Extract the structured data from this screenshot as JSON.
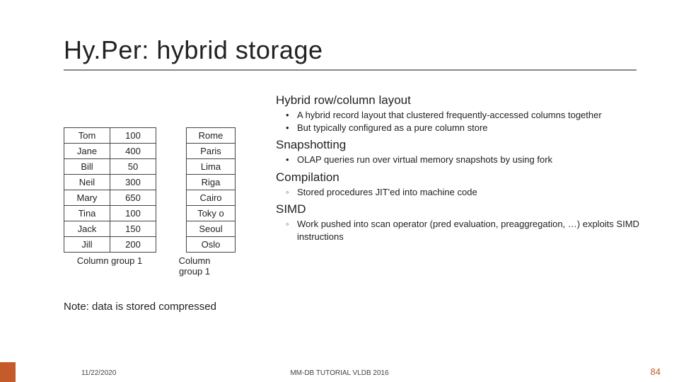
{
  "title": "Hy.Per: hybrid storage",
  "table": {
    "rows": [
      {
        "name": "Tom",
        "val": "100",
        "city": "Rome"
      },
      {
        "name": "Jane",
        "val": "400",
        "city": "Paris"
      },
      {
        "name": "Bill",
        "val": "50",
        "city": "Lima"
      },
      {
        "name": "Neil",
        "val": "300",
        "city": "Riga"
      },
      {
        "name": "Mary",
        "val": "650",
        "city": "Cairo"
      },
      {
        "name": "Tina",
        "val": "100",
        "city": "Toky o"
      },
      {
        "name": "Jack",
        "val": "150",
        "city": "Seoul"
      },
      {
        "name": "Jill",
        "val": "200",
        "city": "Oslo"
      }
    ],
    "caption_left": "Column group 1",
    "caption_right": "Column group 1"
  },
  "note": "Note: data is stored compressed",
  "sections": [
    {
      "heading": "Hybrid row/column layout",
      "bullets": [
        "A hybrid record layout that clustered frequently-accessed columns together",
        "But typically configured as a pure column store"
      ],
      "marker": "•"
    },
    {
      "heading": "Snapshotting",
      "bullets": [
        "OLAP queries run over virtual memory snapshots by using fork"
      ],
      "marker": "•"
    },
    {
      "heading": "Compilation",
      "bullets": [
        "Stored procedures JIT'ed into machine code"
      ],
      "marker": "◦"
    },
    {
      "heading": "SIMD",
      "bullets": [
        "Work pushed into scan operator (pred evaluation, preaggregation, …) exploits SIMD instructions"
      ],
      "marker": "◦"
    }
  ],
  "footer": {
    "date": "11/22/2020",
    "mid": "MM-DB TUTORIAL VLDB 2016",
    "page": "84"
  }
}
